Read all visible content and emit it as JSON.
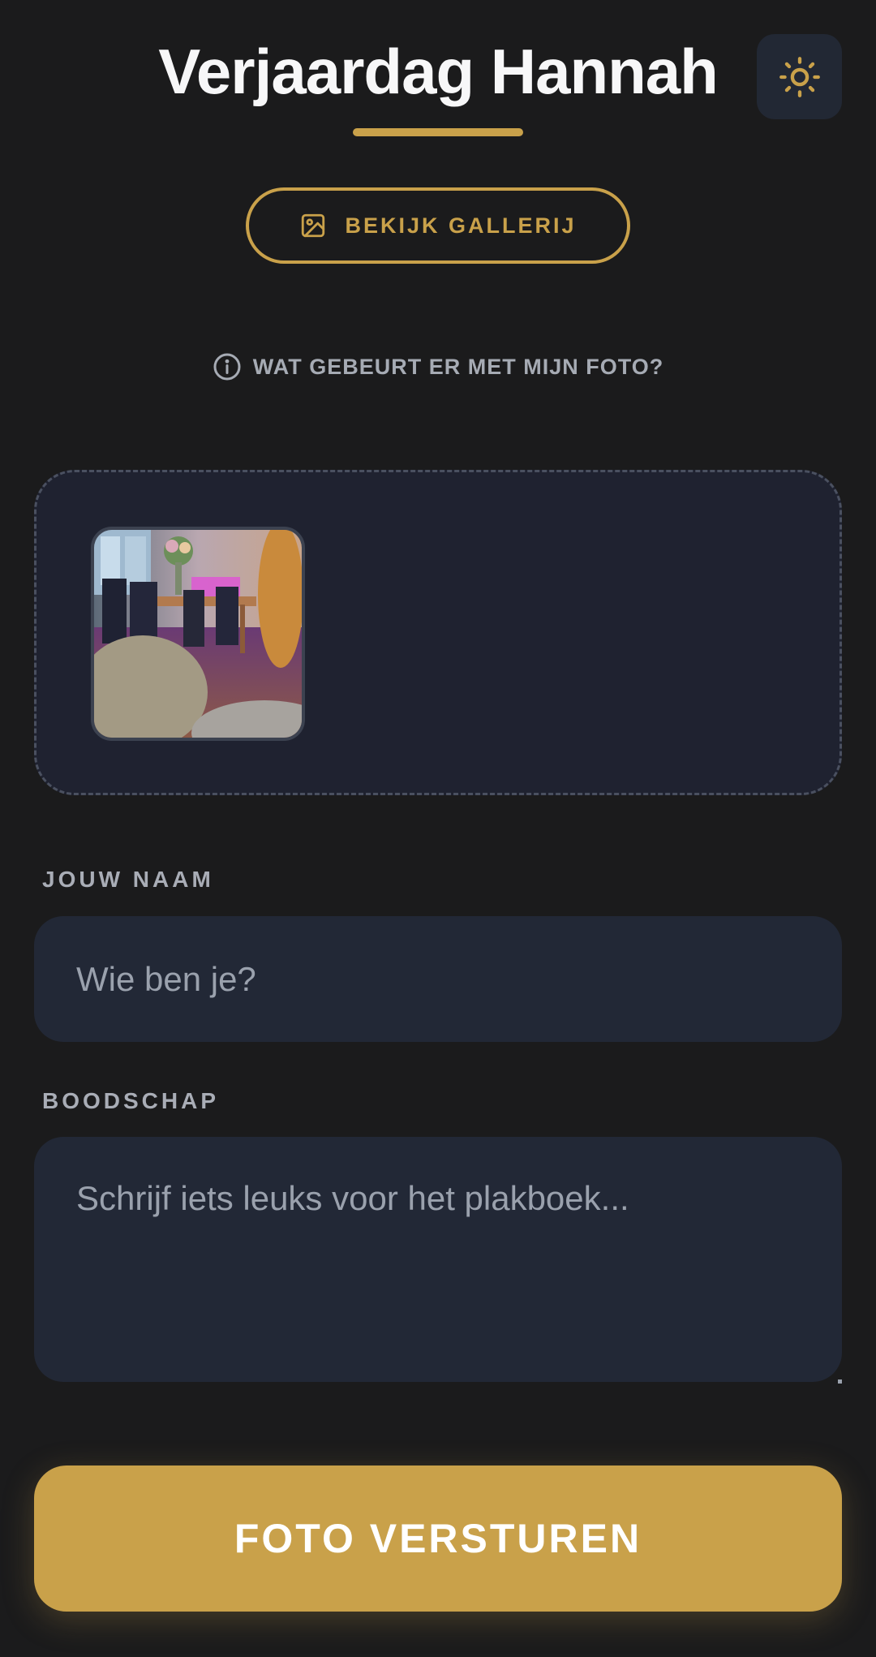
{
  "header": {
    "title": "Verjaardag Hannah",
    "theme_toggle_icon": "sun-icon"
  },
  "gallery_button": {
    "icon": "image-icon",
    "label": "BEKIJK GALLERIJ"
  },
  "info_link": {
    "icon": "info-circle-icon",
    "label": "WAT GEBEURT ER MET MIJN FOTO?"
  },
  "upload": {
    "thumbnail_count": 1
  },
  "form": {
    "name_label": "JOUW NAAM",
    "name_placeholder": "Wie ben je?",
    "name_value": "",
    "message_label": "BOODSCHAP",
    "message_placeholder": "Schrijf iets leuks voor het plakboek...",
    "message_value": ""
  },
  "submit": {
    "label": "FOTO VERSTUREN"
  },
  "colors": {
    "background": "#1b1b1c",
    "accent": "#c9a14a",
    "panel": "#222836",
    "dropzone": "#1f2230"
  }
}
